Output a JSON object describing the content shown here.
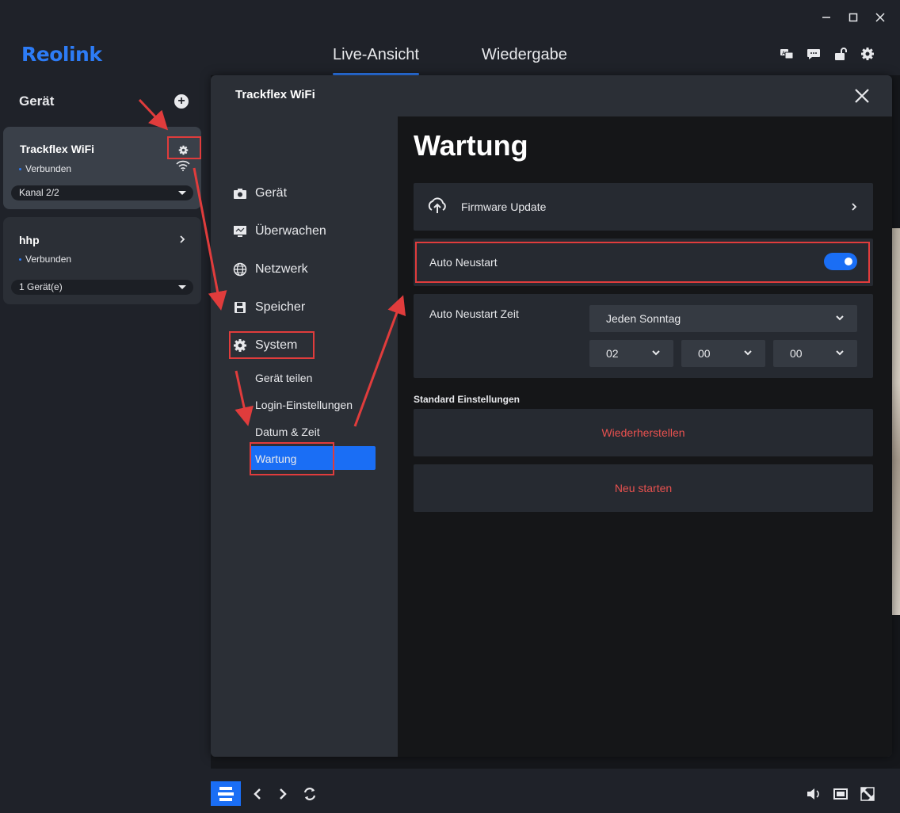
{
  "window": {
    "controls": [
      "minimize",
      "maximize",
      "close"
    ]
  },
  "header": {
    "logo": "Reolink",
    "tabs": [
      {
        "label": "Live-Ansicht",
        "active": true
      },
      {
        "label": "Wiedergabe",
        "active": false
      }
    ],
    "icons": [
      "translate-icon",
      "message-icon",
      "unlock-icon",
      "gear-icon"
    ],
    "accent_color": "#2d7cf6"
  },
  "sidebar": {
    "title": "Gerät",
    "devices": [
      {
        "name": "Trackflex WiFi",
        "status": "Verbunden",
        "selector": "Kanal 2/2",
        "has_wifi": true
      },
      {
        "name": "hhp",
        "status": "Verbunden",
        "selector": "1 Gerät(e)"
      }
    ]
  },
  "modal": {
    "title": "Trackflex WiFi",
    "nav": [
      {
        "label": "Gerät",
        "icon": "camera-icon"
      },
      {
        "label": "Überwachen",
        "icon": "monitor-icon"
      },
      {
        "label": "Netzwerk",
        "icon": "globe-icon"
      },
      {
        "label": "Speicher",
        "icon": "storage-icon"
      },
      {
        "label": "System",
        "icon": "gear-icon"
      }
    ],
    "system_sub": [
      "Gerät teilen",
      "Login-Einstellungen",
      "Datum & Zeit",
      "Wartung"
    ],
    "active_sub": "Wartung",
    "content": {
      "heading": "Wartung",
      "firmware_label": "Firmware Update",
      "auto_restart_label": "Auto Neustart",
      "auto_restart_on": true,
      "auto_restart_time_label": "Auto Neustart Zeit",
      "day_value": "Jeden Sonntag",
      "hour_value": "02",
      "minute_value": "00",
      "second_value": "00",
      "defaults_label": "Standard Einstellungen",
      "restore_label": "Wiederherstellen",
      "reboot_label": "Neu starten",
      "danger_color": "#e8514f"
    }
  },
  "annotation_color": "#e03c3c"
}
